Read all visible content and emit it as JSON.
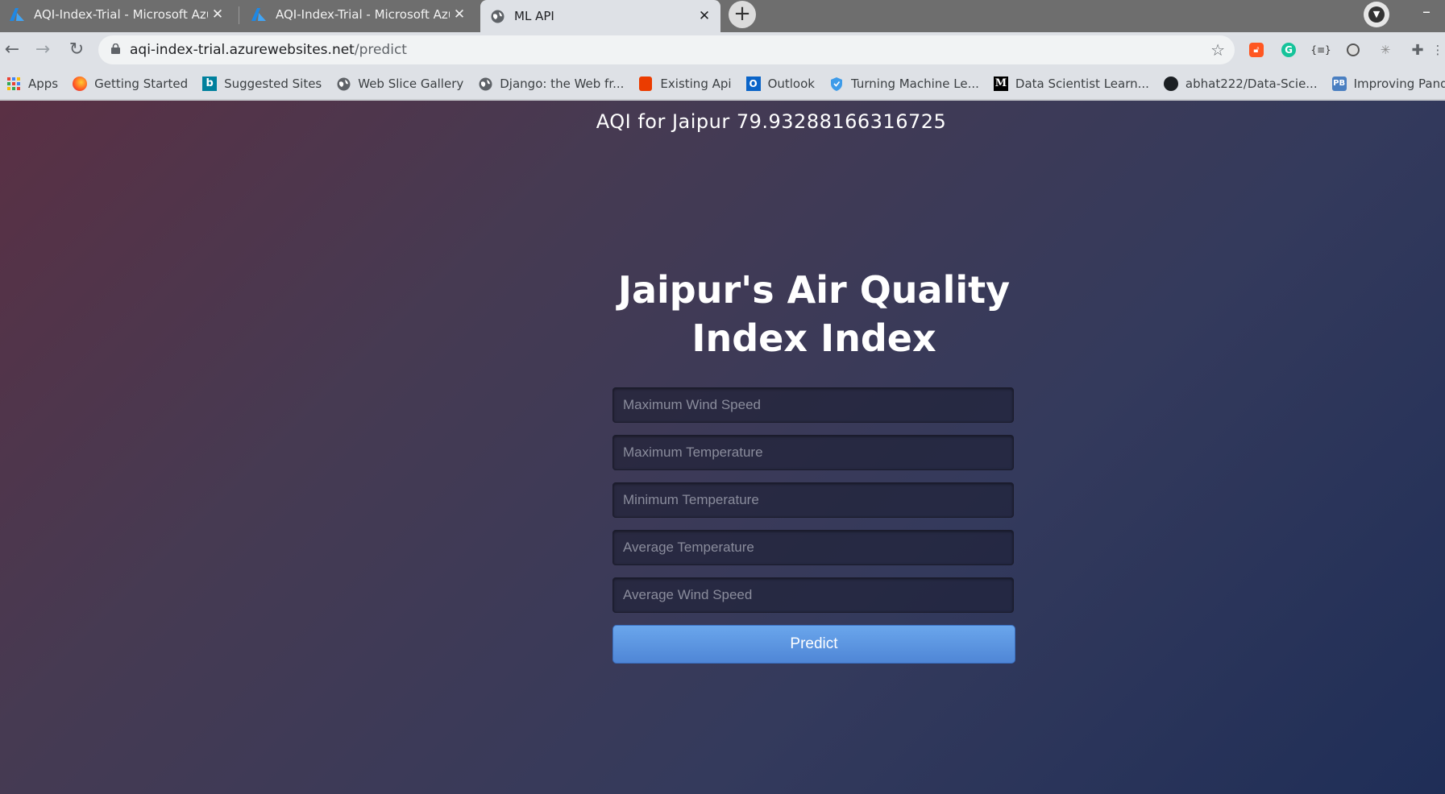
{
  "browser": {
    "tabs": [
      {
        "title": "AQI-Index-Trial - Microsoft Azure",
        "icon": "azure-icon",
        "close": "✕"
      },
      {
        "title": "AQI-Index-Trial - Microsoft Azure",
        "icon": "azure-icon",
        "close": "✕"
      },
      {
        "title": "ML API",
        "icon": "globe-icon",
        "close": "✕"
      }
    ],
    "new_tab": "+",
    "address": {
      "domain": "aqi-index-trial.azurewebsites.net",
      "path": "/predict"
    },
    "bookmarks": [
      {
        "label": "Apps",
        "icon": "apps-grid-icon"
      },
      {
        "label": "Getting Started",
        "icon": "firefox-icon"
      },
      {
        "label": "Suggested Sites",
        "icon": "bing-icon"
      },
      {
        "label": "Web Slice Gallery",
        "icon": "globe-icon"
      },
      {
        "label": "Django: the Web fr...",
        "icon": "globe-icon"
      },
      {
        "label": "Existing Api",
        "icon": "office-icon"
      },
      {
        "label": "Outlook",
        "icon": "outlook-icon"
      },
      {
        "label": "Turning Machine Le...",
        "icon": "shield-icon"
      },
      {
        "label": "Data Scientist Learn...",
        "icon": "medium-icon"
      },
      {
        "label": "abhat222/Data-Scie...",
        "icon": "github-icon"
      },
      {
        "label": "Improving Pandas's...",
        "icon": "pb-icon"
      }
    ]
  },
  "page": {
    "result_text": "AQI for Jaipur 79.93288166316725",
    "heading": "Jaipur's Air Quality Index Index",
    "fields": [
      {
        "placeholder": "Maximum Wind Speed"
      },
      {
        "placeholder": "Maximum Temperature"
      },
      {
        "placeholder": "Minimum Temperature"
      },
      {
        "placeholder": "Average Temperature"
      },
      {
        "placeholder": "Average Wind Speed"
      }
    ],
    "submit_label": "Predict"
  },
  "colors": {
    "button": "#5a93e0",
    "page_gradient_start": "#5a3044",
    "page_gradient_end": "#1f2e57"
  }
}
